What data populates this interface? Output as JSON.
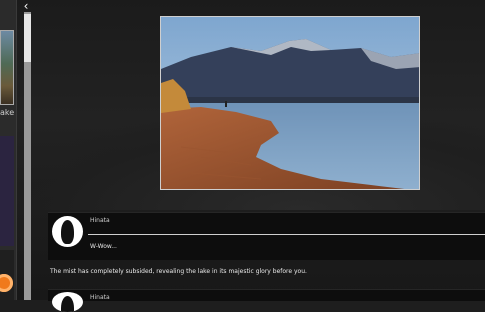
{
  "sidebar": {
    "thumbnail_label": "ake",
    "collapse_label": "‹"
  },
  "scene": {
    "image_subject": "mountain lake at sunset"
  },
  "dialog": {
    "speaker_name": "Hinata",
    "speech": "W-Wow...",
    "narration": "The mist has completely subsided, revealing the lake in its majestic glory before you.",
    "next_speaker_name": "Hinata"
  },
  "colors": {
    "background": "#1e1e1e",
    "panel": "#0d0d0d",
    "accent": "#f07a1c"
  }
}
